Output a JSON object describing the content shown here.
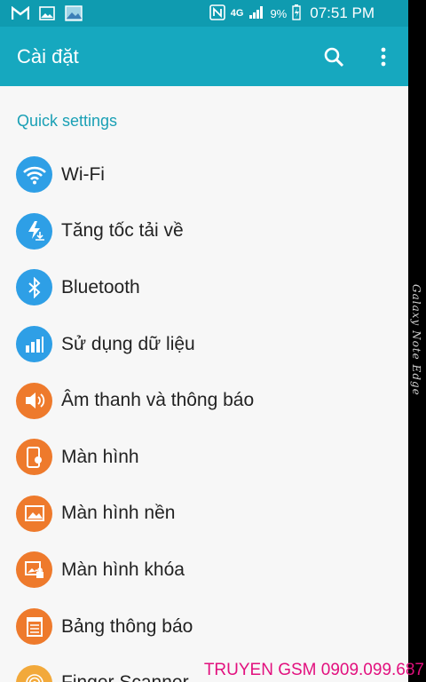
{
  "status_bar": {
    "icons_left": [
      "gmail-icon",
      "image-icon",
      "gallery-icon"
    ],
    "icons_right": [
      "nfc-icon",
      "4g-icon",
      "signal-icon",
      "battery-icon"
    ],
    "network": "4G",
    "battery": "9%",
    "time": "07:51 PM"
  },
  "app_bar": {
    "title": "Cài đặt",
    "actions": [
      "search-icon",
      "more-vert-icon"
    ]
  },
  "section": {
    "title": "Quick settings"
  },
  "items": [
    {
      "label": "Wi-Fi",
      "icon": "wifi-icon",
      "color": "#2e9fe6"
    },
    {
      "label": "Tăng tốc tải về",
      "icon": "download-booster-icon",
      "color": "#2e9fe6"
    },
    {
      "label": "Bluetooth",
      "icon": "bluetooth-icon",
      "color": "#2e9fe6"
    },
    {
      "label": "Sử dụng dữ liệu",
      "icon": "data-usage-icon",
      "color": "#2e9fe6"
    },
    {
      "label": "Âm thanh và thông báo",
      "icon": "sound-icon",
      "color": "#ee7a2c"
    },
    {
      "label": "Màn hình",
      "icon": "display-icon",
      "color": "#ee7a2c"
    },
    {
      "label": "Màn hình nền",
      "icon": "wallpaper-icon",
      "color": "#ee7a2c"
    },
    {
      "label": "Màn hình khóa",
      "icon": "lock-screen-icon",
      "color": "#ee7a2c"
    },
    {
      "label": "Bảng thông báo",
      "icon": "notification-panel-icon",
      "color": "#ee7a2c"
    },
    {
      "label": "Finger Scanner",
      "icon": "fingerprint-icon",
      "color": "#f2a93b"
    }
  ],
  "edge_label": "Galaxy Note Edge",
  "watermark": "TRUYEN GSM 0909.099.687",
  "colors": {
    "status_bar": "#0f9bb0",
    "app_bar": "#16a8bf",
    "accent": "#1aa0b5",
    "blue_icon": "#2e9fe6",
    "orange_icon": "#ee7a2c"
  }
}
